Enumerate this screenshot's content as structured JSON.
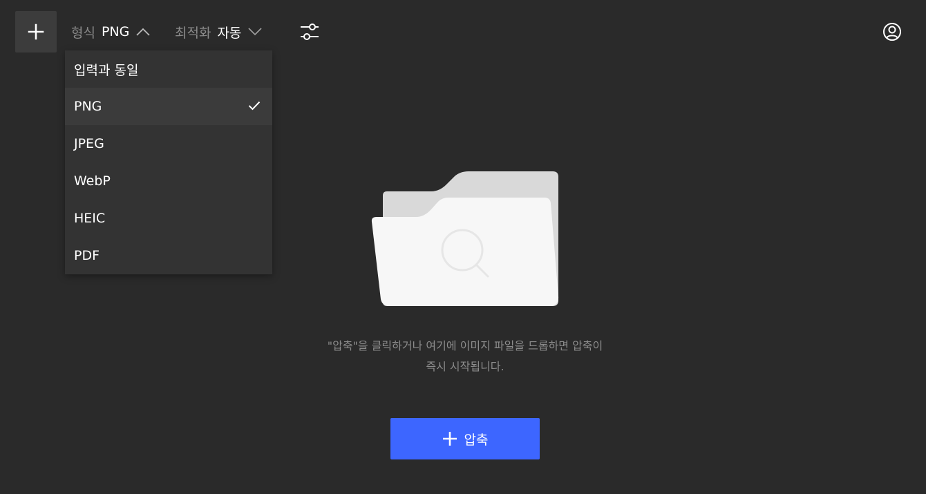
{
  "toolbar": {
    "add_icon": "plus-icon",
    "format_label": "형식",
    "format_value": "PNG",
    "format_chevron": "chevron-up-icon",
    "optimize_label": "최적화",
    "optimize_value": "자동",
    "optimize_chevron": "chevron-down-icon",
    "settings_icon": "sliders-icon",
    "account_icon": "user-circle-icon"
  },
  "format_dropdown": {
    "items": [
      {
        "label": "입력과 동일",
        "selected": false
      },
      {
        "label": "PNG",
        "selected": true
      },
      {
        "label": "JPEG",
        "selected": false
      },
      {
        "label": "WebP",
        "selected": false
      },
      {
        "label": "HEIC",
        "selected": false
      },
      {
        "label": "PDF",
        "selected": false
      }
    ],
    "selected_icon": "checkmark-icon"
  },
  "empty_state": {
    "illustration": "folder-search-icon",
    "message_line1": "\"압축\"을 클릭하거나 여기에 이미지 파일을 드롭하면 압축이",
    "message_line2": "즉시 시작됩니다."
  },
  "compress_button": {
    "icon": "plus-icon",
    "label": "압축"
  },
  "colors": {
    "background": "#2a2a2a",
    "dropdown_bg": "#333333",
    "dropdown_selected_bg": "#3b3b3b",
    "accent": "#3d66ff",
    "muted_text": "#8c8c8c"
  }
}
